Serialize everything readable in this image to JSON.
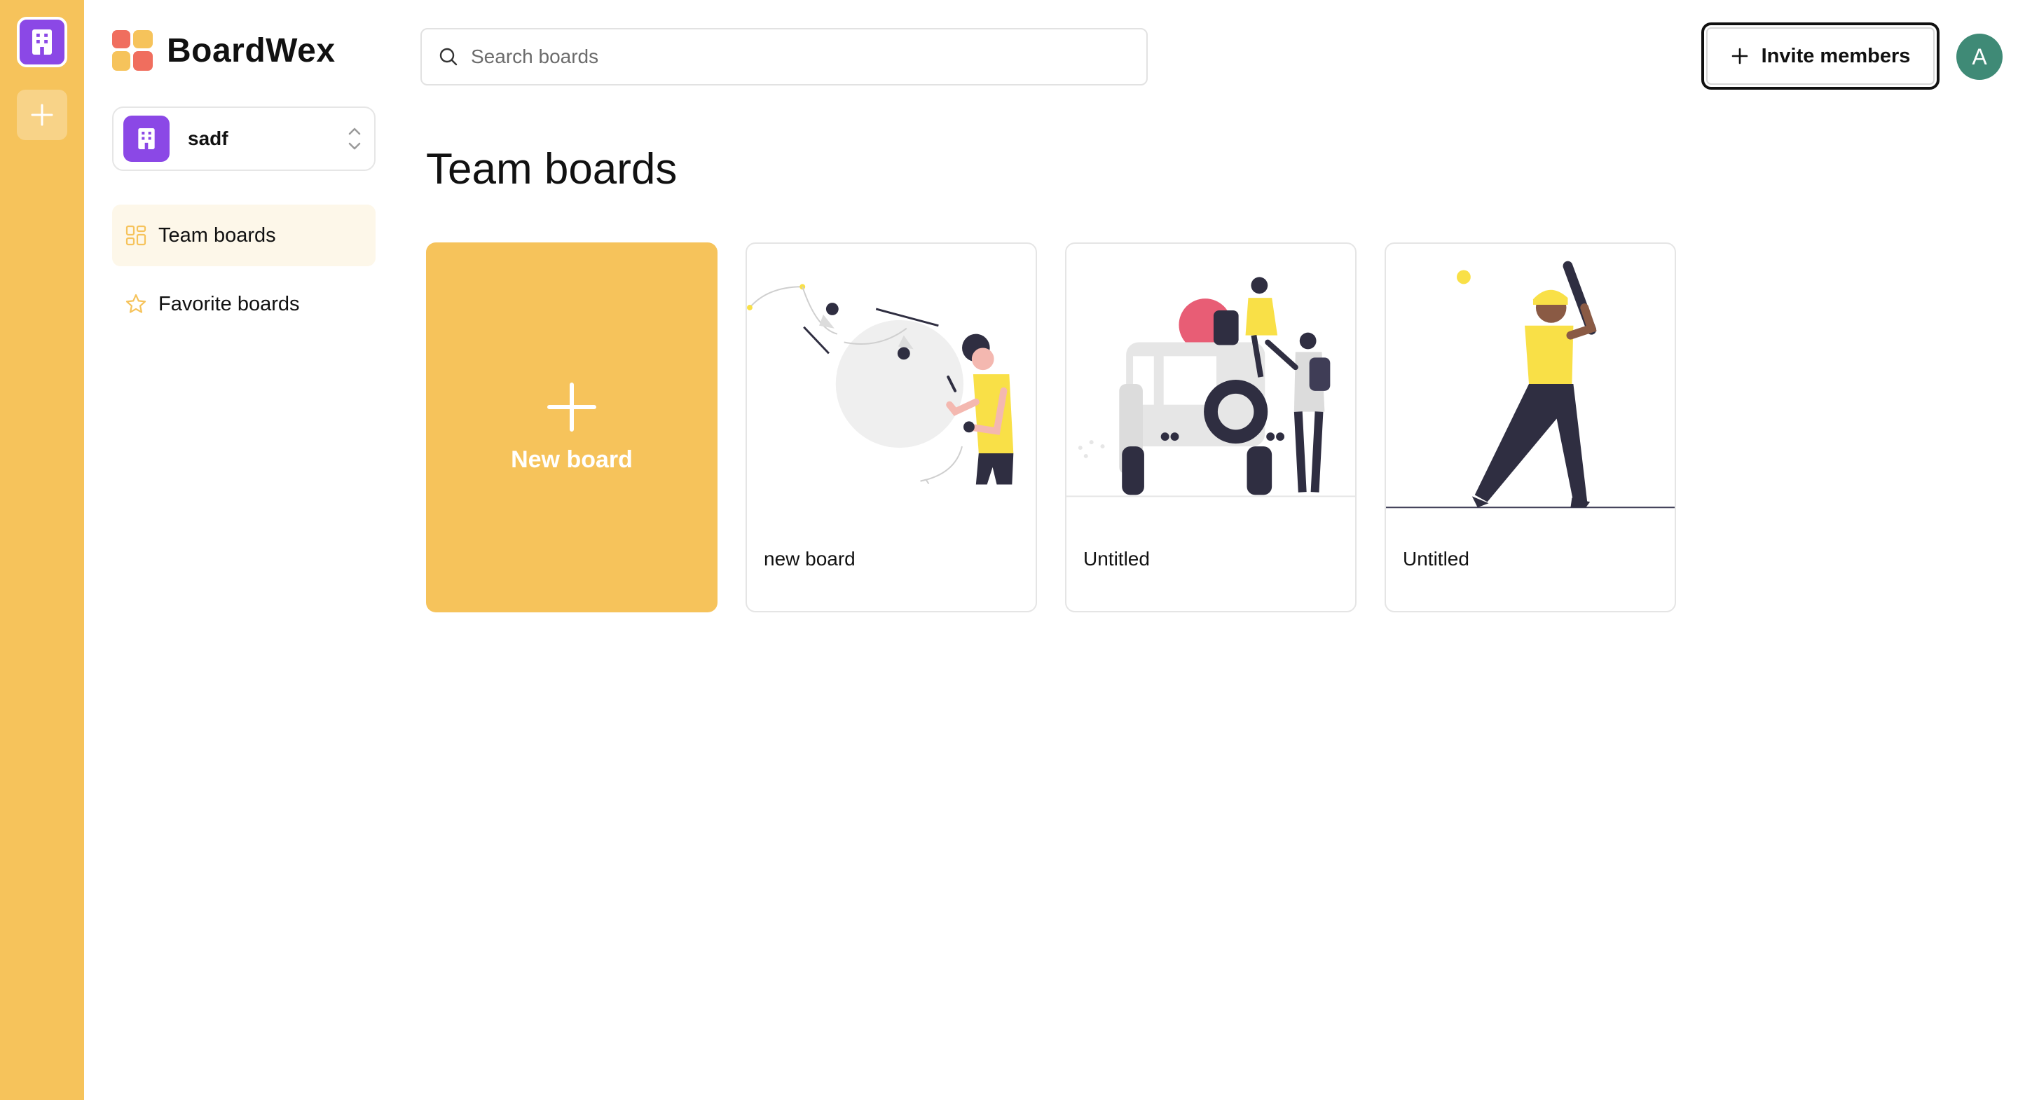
{
  "app": {
    "name": "BoardWex"
  },
  "organization": {
    "name": "sadf"
  },
  "sidebar": {
    "items": [
      {
        "label": "Team boards",
        "icon": "dashboard-icon",
        "active": true
      },
      {
        "label": "Favorite boards",
        "icon": "star-icon",
        "active": false
      }
    ]
  },
  "search": {
    "placeholder": "Search boards",
    "value": ""
  },
  "header": {
    "invite_label": "Invite members",
    "user_initial": "A"
  },
  "main": {
    "title": "Team boards",
    "new_board_label": "New board",
    "boards": [
      {
        "title": "new board",
        "illustration": "woman-with-balloon-illustration"
      },
      {
        "title": "Untitled",
        "illustration": "jeep-travelers-illustration"
      },
      {
        "title": "Untitled",
        "illustration": "baseball-batter-illustration"
      }
    ]
  },
  "colors": {
    "accent": "#f6c35b",
    "org_purple": "#8b48e6",
    "avatar_green": "#3f8a76",
    "illustration_yellow": "#f9e047",
    "illustration_dark": "#2f2e41",
    "illustration_pink": "#e85d75"
  }
}
